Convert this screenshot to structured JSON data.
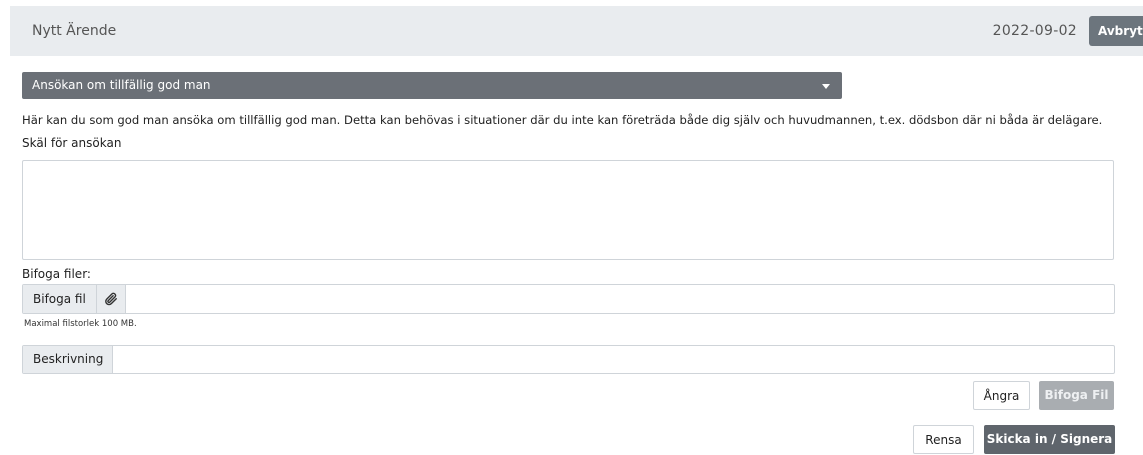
{
  "header": {
    "title": "Nytt Ärende",
    "date": "2022-09-02",
    "cancel_label": "Avbryt"
  },
  "application_type": {
    "selected": "Ansökan om tillfällig god man"
  },
  "description": "Här kan du som god man ansöka om tillfällig god man. Detta kan behövas i situationer där du inte kan företräda både dig själv och huvudmannen, t.ex. dödsbon där ni båda är delägare.",
  "reason": {
    "label": "Skäl för ansökan",
    "value": ""
  },
  "attachments": {
    "label": "Bifoga filer:",
    "file_button": "Bifoga fil",
    "file_value": "",
    "hint": "Maximal filstorlek 100 MB.",
    "description_label": "Beskrivning",
    "description_value": "",
    "undo_label": "Ångra",
    "attach_label": "Bifoga Fil"
  },
  "footer": {
    "clear_label": "Rensa",
    "submit_label": "Skicka in / Signera"
  },
  "icons": {
    "caret": "caret-down-icon",
    "clip": "paperclip-icon"
  }
}
